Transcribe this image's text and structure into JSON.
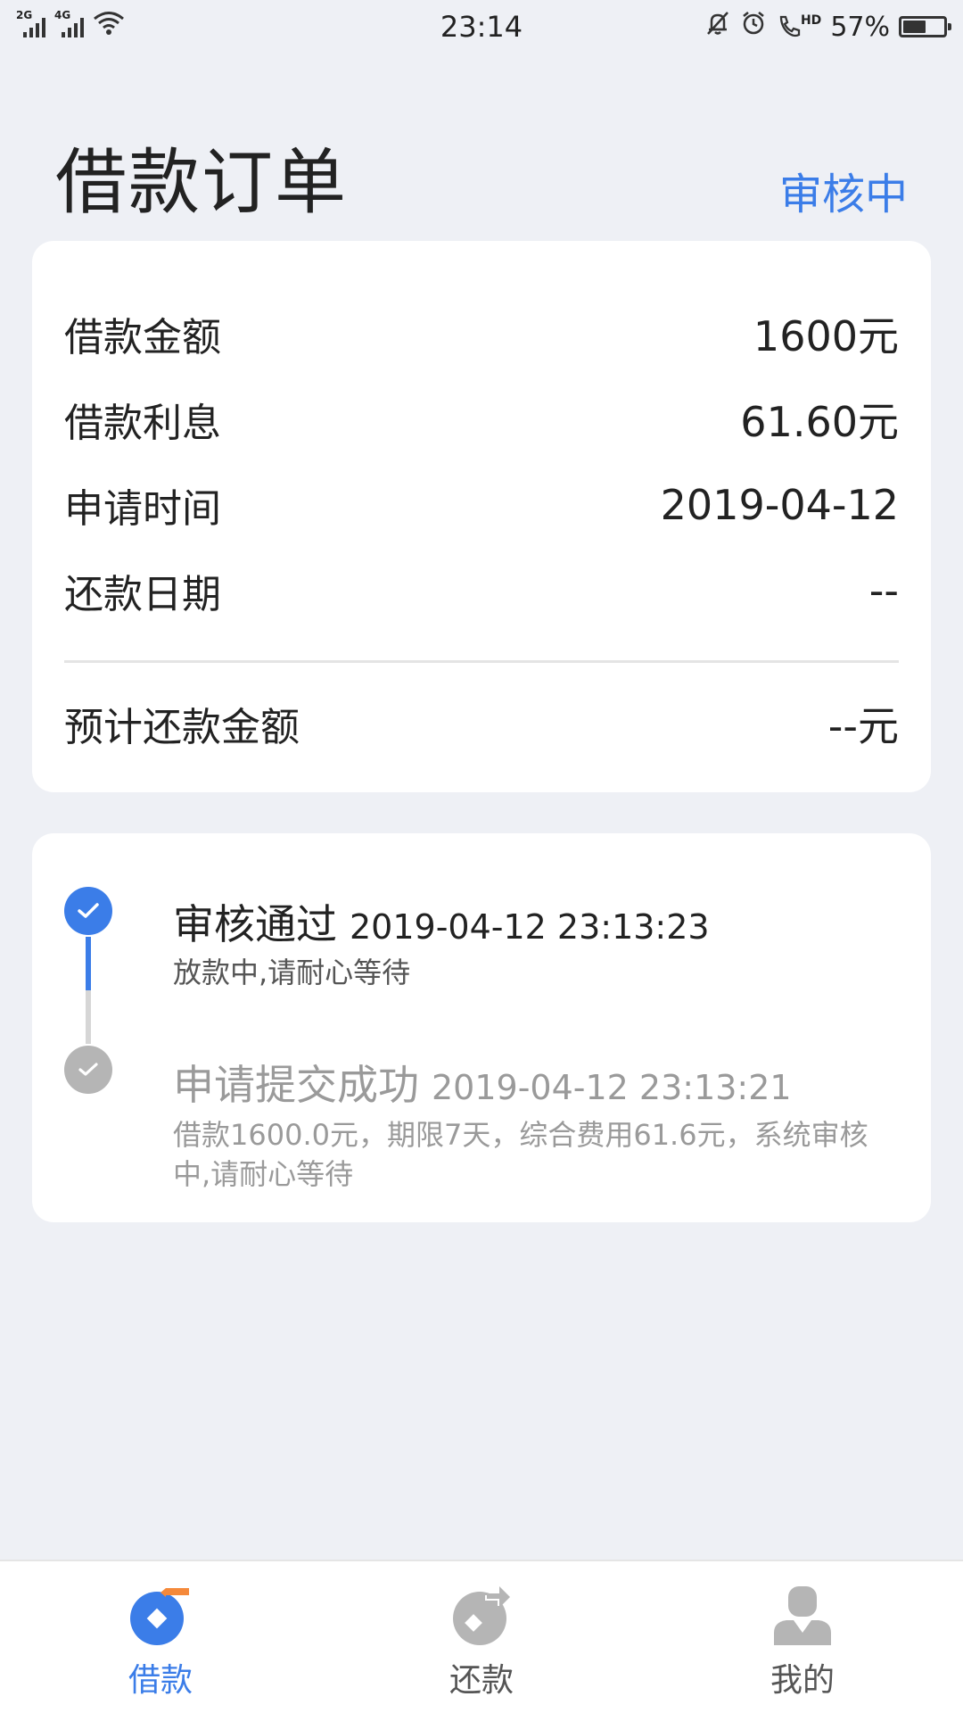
{
  "status_bar": {
    "time": "23:14",
    "battery": "57%",
    "battery_level": 0.57,
    "hd_label": "HD",
    "net1": "2G",
    "net2": "4G"
  },
  "header": {
    "title": "借款订单",
    "status": "审核中"
  },
  "summary": {
    "rows": [
      {
        "label": "借款金额",
        "value": "1600元"
      },
      {
        "label": "借款利息",
        "value": "61.60元"
      },
      {
        "label": "申请时间",
        "value": "2019-04-12"
      },
      {
        "label": "还款日期",
        "value": "--"
      }
    ],
    "total": {
      "label": "预计还款金额",
      "value": "--元"
    }
  },
  "timeline": {
    "steps": [
      {
        "title": "审核通过",
        "timestamp": "2019-04-12 23:13:23",
        "description": "放款中,请耐心等待",
        "state": "active"
      },
      {
        "title": "申请提交成功",
        "timestamp": "2019-04-12 23:13:21",
        "description": "借款1600.0元，期限7天，综合费用61.6元，系统审核中,请耐心等待",
        "state": "done"
      }
    ]
  },
  "nav": {
    "items": [
      {
        "label": "借款",
        "icon": "loan-icon",
        "active": true
      },
      {
        "label": "还款",
        "icon": "repay-icon",
        "active": false
      },
      {
        "label": "我的",
        "icon": "profile-icon",
        "active": false
      }
    ]
  },
  "colors": {
    "accent": "#3b7de8",
    "accent_orange": "#f5893a",
    "inactive": "#b5b5b5",
    "muted_text": "#9a9a9a",
    "background": "#eef0f5"
  }
}
